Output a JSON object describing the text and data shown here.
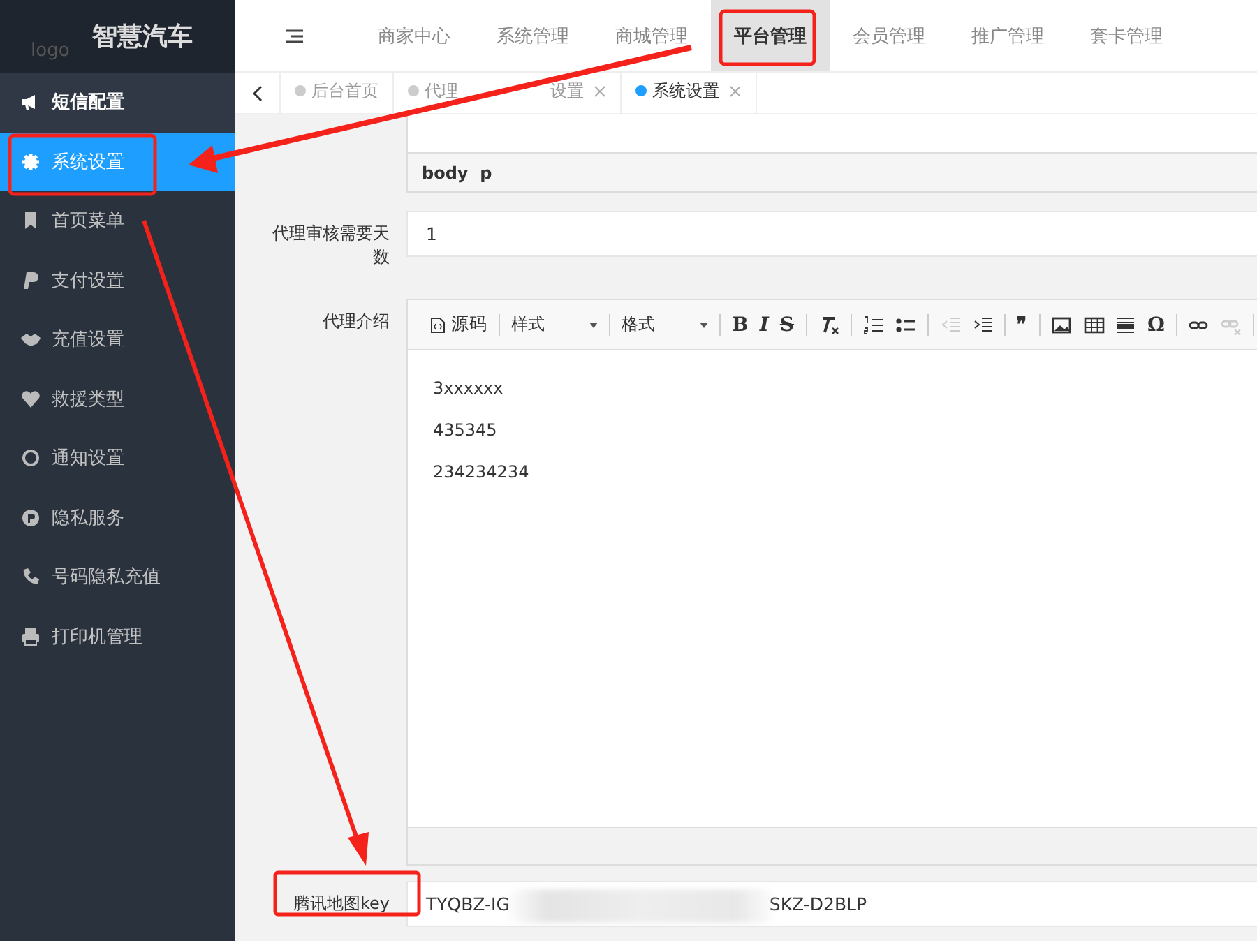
{
  "sidebar": {
    "logo_alt": "logo",
    "brand": "智慧汽车",
    "items": [
      {
        "label": "短信配置",
        "kind": "group",
        "selected": false
      },
      {
        "label": "系统设置",
        "kind": "item",
        "selected": true
      },
      {
        "label": "首页菜单",
        "kind": "item",
        "selected": false
      },
      {
        "label": "支付设置",
        "kind": "item",
        "selected": false
      },
      {
        "label": "充值设置",
        "kind": "item",
        "selected": false
      },
      {
        "label": "救援类型",
        "kind": "item",
        "selected": false
      },
      {
        "label": "通知设置",
        "kind": "item",
        "selected": false
      },
      {
        "label": "隐私服务",
        "kind": "item",
        "selected": false
      },
      {
        "label": "号码隐私充值",
        "kind": "item",
        "selected": false
      },
      {
        "label": "打印机管理",
        "kind": "item",
        "selected": false
      }
    ]
  },
  "top_nav": {
    "items": [
      {
        "label": "商家中心",
        "selected": false
      },
      {
        "label": "系统管理",
        "selected": false
      },
      {
        "label": "商城管理",
        "selected": false
      },
      {
        "label": "平台管理",
        "selected": true
      },
      {
        "label": "会员管理",
        "selected": false
      },
      {
        "label": "推广管理",
        "selected": false
      },
      {
        "label": "套卡管理",
        "selected": false
      }
    ]
  },
  "tabs": [
    {
      "label": "后台首页",
      "selected": false,
      "closable": false
    },
    {
      "label": "代理",
      "label_end": "设置",
      "selected": false,
      "closable": true
    },
    {
      "label": "系统设置",
      "selected": true,
      "closable": true
    }
  ],
  "form": {
    "upper_editor": {
      "path": "body  p"
    },
    "fields": [
      {
        "kind": "input",
        "label": "代理审核需要天数",
        "value": "1"
      },
      {
        "kind": "editor",
        "label": "代理介绍",
        "toolbar_groups": [
          {
            "buttons": [
              {
                "kind": "source",
                "label": "源码",
                "disabled": false
              }
            ]
          },
          {
            "buttons": [
              {
                "kind": "select",
                "label": "样式",
                "disabled": false
              }
            ]
          },
          {
            "buttons": [
              {
                "kind": "select",
                "label": "格式",
                "disabled": false
              }
            ]
          },
          {
            "buttons": [
              {
                "kind": "bold",
                "label": "B",
                "disabled": false
              },
              {
                "kind": "italic",
                "label": "I",
                "disabled": false
              },
              {
                "kind": "strike",
                "label": "S",
                "disabled": false
              }
            ]
          },
          {
            "buttons": [
              {
                "kind": "clear",
                "disabled": false
              }
            ]
          },
          {
            "buttons": [
              {
                "kind": "ol",
                "disabled": false
              },
              {
                "kind": "ul",
                "disabled": false
              }
            ]
          },
          {
            "buttons": [
              {
                "kind": "outdent",
                "disabled": true
              },
              {
                "kind": "indent",
                "disabled": false
              }
            ]
          },
          {
            "buttons": [
              {
                "kind": "quote",
                "label": "❞",
                "disabled": false
              }
            ]
          },
          {
            "buttons": [
              {
                "kind": "image",
                "disabled": false
              },
              {
                "kind": "table",
                "disabled": false
              },
              {
                "kind": "hr",
                "disabled": false
              },
              {
                "kind": "omega",
                "label": "Ω",
                "disabled": false
              }
            ]
          },
          {
            "buttons": [
              {
                "kind": "link",
                "disabled": false
              },
              {
                "kind": "unlink",
                "disabled": true
              }
            ]
          }
        ],
        "paragraphs": [
          "3xxxxxx",
          "435345",
          "234234234"
        ]
      },
      {
        "kind": "redacted",
        "label": "腾讯地图key",
        "value_start": "TYQBZ-IG",
        "value_end": "SKZ-D2BLP"
      }
    ]
  }
}
